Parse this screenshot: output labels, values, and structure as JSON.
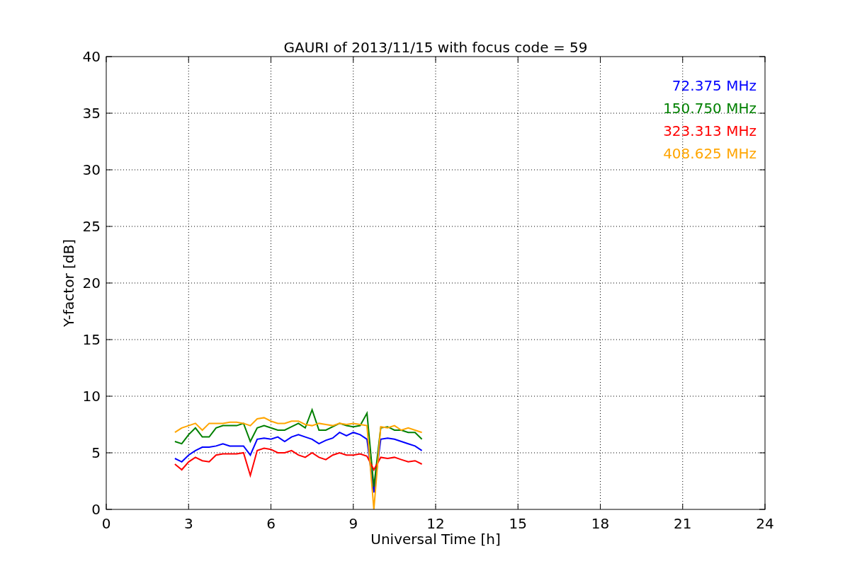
{
  "chart_data": {
    "type": "line",
    "title": "GAURI of 2013/11/15 with focus code = 59",
    "xlabel": "Universal Time [h]",
    "ylabel": "Y-factor [dB]",
    "x": [
      2.5,
      2.75,
      3,
      3.25,
      3.5,
      3.75,
      4,
      4.25,
      4.5,
      4.75,
      5,
      5.25,
      5.5,
      5.75,
      6,
      6.25,
      6.5,
      6.75,
      7,
      7.25,
      7.5,
      7.75,
      8,
      8.25,
      8.5,
      8.75,
      9,
      9.25,
      9.5,
      9.75,
      10,
      10.25,
      10.5,
      10.75,
      11,
      11.25,
      11.5
    ],
    "series": [
      {
        "name": "72.375 MHz",
        "color": "#0000ff",
        "values": [
          4.5,
          4.2,
          4.8,
          5.2,
          5.5,
          5.5,
          5.6,
          5.8,
          5.6,
          5.6,
          5.6,
          4.8,
          6.2,
          6.3,
          6.2,
          6.4,
          6.0,
          6.4,
          6.6,
          6.4,
          6.2,
          5.8,
          6.1,
          6.3,
          6.8,
          6.5,
          6.8,
          6.6,
          6.2,
          1.5,
          6.2,
          6.3,
          6.2,
          6.0,
          5.8,
          5.6,
          5.2
        ]
      },
      {
        "name": "150.750 MHz",
        "color": "#008000",
        "values": [
          6.0,
          5.8,
          6.6,
          7.2,
          6.4,
          6.4,
          7.2,
          7.4,
          7.4,
          7.4,
          7.6,
          6.0,
          7.2,
          7.4,
          7.2,
          7.0,
          7.0,
          7.3,
          7.6,
          7.2,
          8.8,
          7.0,
          7.0,
          7.3,
          7.6,
          7.4,
          7.3,
          7.4,
          8.5,
          2.0,
          7.2,
          7.3,
          7.0,
          7.0,
          6.8,
          6.8,
          6.2
        ]
      },
      {
        "name": "323.313 MHz",
        "color": "#ff0000",
        "values": [
          4.0,
          3.5,
          4.2,
          4.6,
          4.3,
          4.2,
          4.8,
          4.9,
          4.9,
          4.9,
          5.0,
          3.0,
          5.2,
          5.4,
          5.3,
          5.0,
          5.0,
          5.2,
          4.8,
          4.6,
          5.0,
          4.6,
          4.4,
          4.8,
          5.0,
          4.8,
          4.8,
          4.9,
          4.7,
          3.5,
          4.6,
          4.5,
          4.6,
          4.4,
          4.2,
          4.3,
          4.0
        ]
      },
      {
        "name": "408.625 MHz",
        "color": "#ffa500",
        "values": [
          6.8,
          7.2,
          7.4,
          7.6,
          7.0,
          7.6,
          7.6,
          7.6,
          7.7,
          7.7,
          7.6,
          7.4,
          8.0,
          8.1,
          7.8,
          7.6,
          7.6,
          7.8,
          7.8,
          7.5,
          7.4,
          7.6,
          7.5,
          7.4,
          7.6,
          7.5,
          7.6,
          7.5,
          7.4,
          0.0,
          7.3,
          7.2,
          7.4,
          7.0,
          7.2,
          7.0,
          6.8
        ]
      }
    ],
    "grid": true,
    "xlim": [
      0,
      24
    ],
    "ylim": [
      0,
      40
    ],
    "xticks": [
      0,
      3,
      6,
      9,
      12,
      15,
      18,
      21,
      24
    ],
    "yticks": [
      0,
      5,
      10,
      15,
      20,
      25,
      30,
      35,
      40
    ]
  }
}
